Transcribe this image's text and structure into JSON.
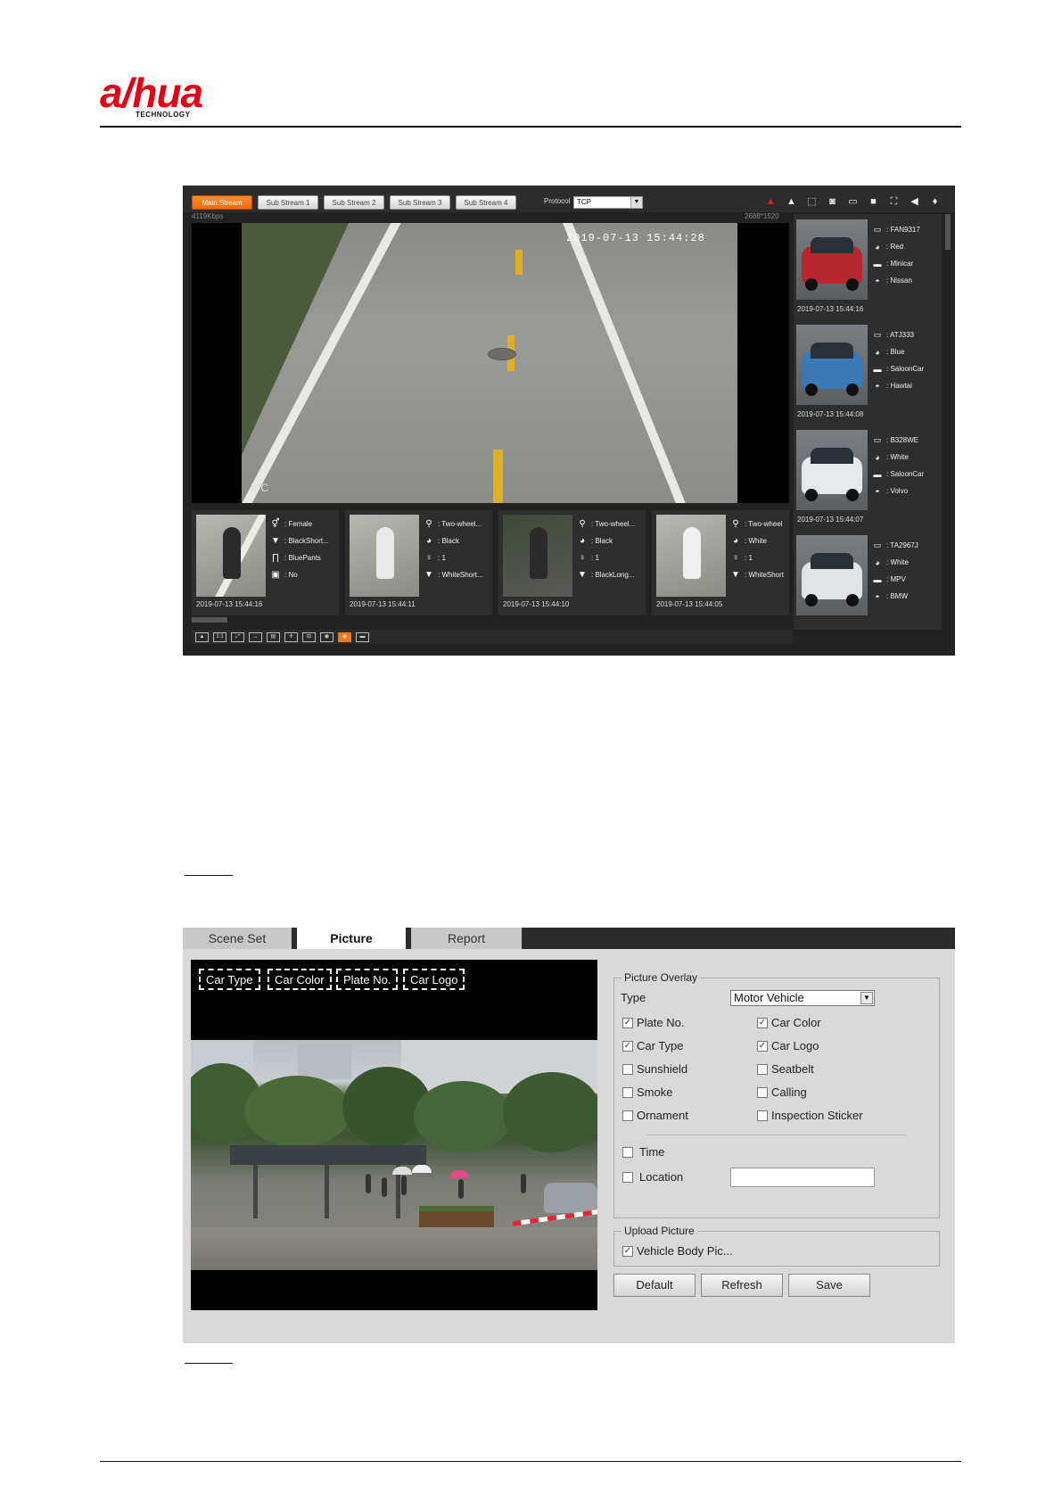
{
  "brand": {
    "name": "a/hua",
    "sub": "TECHNOLOGY"
  },
  "live": {
    "streams": [
      "Main Stream",
      "Sub Stream 1",
      "Sub Stream 2",
      "Sub Stream 3",
      "Sub Stream 4"
    ],
    "protocol_label": "Protocol",
    "protocol_value": "TCP",
    "bitrate_left": "4119Kbps",
    "bitrate_right": "2688*1520",
    "timestamp": "2019-07-13 15:44:28",
    "osd": "IPC",
    "snaps": [
      {
        "attrs": [
          {
            "icon": "gender-icon",
            "text": ": Female"
          },
          {
            "icon": "shirt-icon",
            "text": ": BlackShort..."
          },
          {
            "icon": "pants-icon",
            "text": ": BluePants"
          },
          {
            "icon": "bag-icon",
            "text": ": No"
          }
        ],
        "time": "2019-07-13 15:44:16"
      },
      {
        "attrs": [
          {
            "icon": "bike-icon",
            "text": ": Two-wheel..."
          },
          {
            "icon": "color-icon",
            "text": ": Black"
          },
          {
            "icon": "person-icon",
            "text": ": 1"
          },
          {
            "icon": "shirt-icon",
            "text": ": WhiteShort..."
          }
        ],
        "time": "2019-07-13 15:44:11"
      },
      {
        "attrs": [
          {
            "icon": "bike-icon",
            "text": ": Two-wheel..."
          },
          {
            "icon": "color-icon",
            "text": ": Black"
          },
          {
            "icon": "person-icon",
            "text": ": 1"
          },
          {
            "icon": "shirt-icon",
            "text": ": BlackLong..."
          }
        ],
        "time": "2019-07-13 15:44:10"
      },
      {
        "attrs": [
          {
            "icon": "bike-icon",
            "text": ": Two-wheel"
          },
          {
            "icon": "color-icon",
            "text": ": White"
          },
          {
            "icon": "person-icon",
            "text": ": 1"
          },
          {
            "icon": "shirt-icon",
            "text": ": WhiteShort"
          }
        ],
        "time": "2019-07-13 15:44:05"
      }
    ],
    "vehicles": [
      {
        "plate": ": FAN9317",
        "color": ": Red",
        "type": ": Minicar",
        "logo": ": Nissan",
        "time": "2019-07-13 15:44:16",
        "paint": "#b8262e"
      },
      {
        "plate": ": ATJ333",
        "color": ": Blue",
        "type": ": SaloonCar",
        "logo": ": Hawtai",
        "time": "2019-07-13 15:44:08",
        "paint": "#3a78b8"
      },
      {
        "plate": ": B328WE",
        "color": ": White",
        "type": ": SaloonCar",
        "logo": ": Volvo",
        "time": "2019-07-13 15:44:07",
        "paint": "#e6e8ea"
      },
      {
        "plate": ": TA2967J",
        "color": ": White",
        "type": ": MPV",
        "logo": ": BMW",
        "time": "",
        "paint": "#e1e3e5"
      }
    ]
  },
  "config": {
    "tabs": [
      "Scene Set",
      "Picture",
      "Report"
    ],
    "active_tab": "Picture",
    "overlay_labels": [
      "Car Type",
      "Car Color",
      "Plate No.",
      "Car Logo"
    ],
    "picture_overlay": {
      "legend": "Picture Overlay",
      "type_label": "Type",
      "type_value": "Motor Vehicle",
      "options": [
        {
          "label": "Plate No.",
          "checked": true
        },
        {
          "label": "Car Color",
          "checked": true
        },
        {
          "label": "Car Type",
          "checked": true
        },
        {
          "label": "Car Logo",
          "checked": true
        },
        {
          "label": "Sunshield",
          "checked": false
        },
        {
          "label": "Seatbelt",
          "checked": false
        },
        {
          "label": "Smoke",
          "checked": false
        },
        {
          "label": "Calling",
          "checked": false
        },
        {
          "label": "Ornament",
          "checked": false
        },
        {
          "label": "Inspection Sticker",
          "checked": false
        }
      ],
      "time_label": "Time",
      "time_checked": false,
      "location_label": "Location",
      "location_checked": false,
      "location_value": ""
    },
    "upload_picture": {
      "legend": "Upload Picture",
      "option_label": "Vehicle Body Pic...",
      "option_checked": true
    },
    "buttons": {
      "default": "Default",
      "refresh": "Refresh",
      "save": "Save"
    }
  }
}
